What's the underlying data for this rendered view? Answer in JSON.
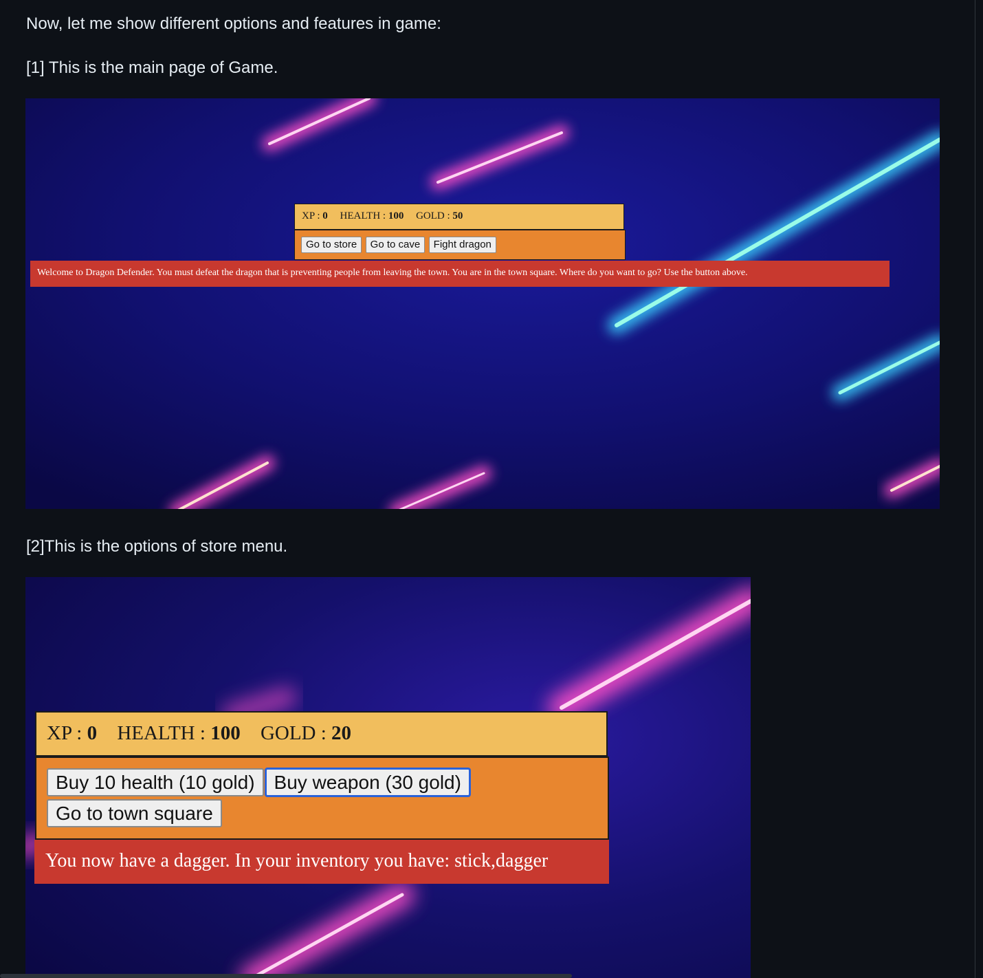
{
  "markdown": {
    "intro": "Now, let me show different options and features in game:",
    "caption_1": "[1] This is the main page of Game.",
    "caption_2": "[2]This is the options of store menu."
  },
  "screenshot_1": {
    "stats": {
      "xp_label": "XP :",
      "xp_value": "0",
      "health_label": "HEALTH :",
      "health_value": "100",
      "gold_label": "GOLD :",
      "gold_value": "50"
    },
    "buttons": {
      "store": "Go to store",
      "cave": "Go to cave",
      "dragon": "Fight dragon"
    },
    "message": "Welcome to Dragon Defender. You must defeat the dragon that is preventing people from leaving the town. You are in the town square. Where do you want to go? Use the button above."
  },
  "screenshot_2": {
    "stats": {
      "xp_label": "XP :",
      "xp_value": "0",
      "health_label": "HEALTH :",
      "health_value": "100",
      "gold_label": "GOLD :",
      "gold_value": "20"
    },
    "buttons": {
      "buy_health": "Buy 10 health (10 gold)",
      "buy_weapon": "Buy weapon (30 gold)",
      "town_square": "Go to town square"
    },
    "message": "You now have a dagger. In your inventory you have: stick,dagger"
  },
  "colors": {
    "page_bg": "#0d1117",
    "text": "#e6edf3",
    "stats_bg": "#f1be5d",
    "controls_bg": "#e8862f",
    "message_bg": "#c8392f",
    "scene_bg": "#0d0a4a",
    "streak_pink": "#ff4fc8",
    "streak_cyan": "#7ff5e8"
  }
}
